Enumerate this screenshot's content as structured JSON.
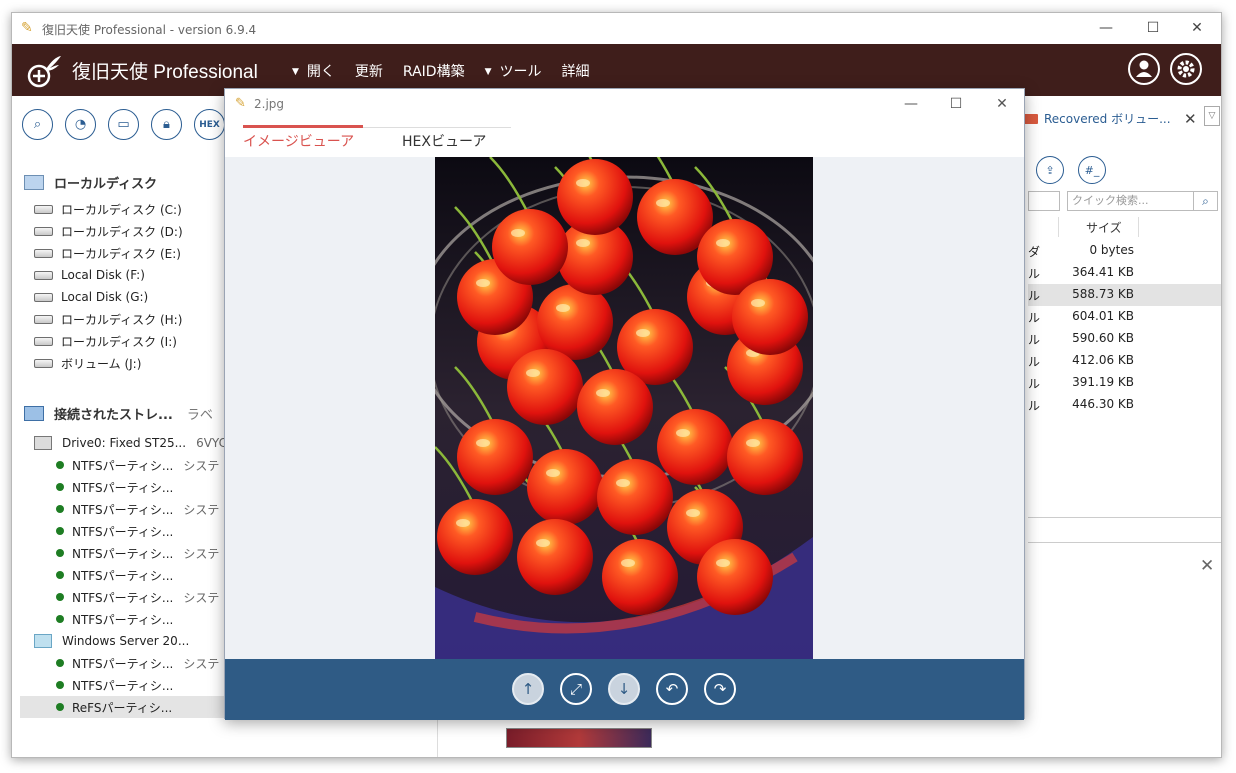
{
  "window": {
    "title": "復旧天使 Professional - version 6.9.4"
  },
  "header": {
    "brand": "復旧天使 Professional",
    "menu": [
      {
        "label": "開く",
        "has_caret": true
      },
      {
        "label": "更新",
        "has_caret": false
      },
      {
        "label": "RAID構築",
        "has_caret": false
      },
      {
        "label": "ツール",
        "has_caret": true
      },
      {
        "label": "詳細",
        "has_caret": false
      }
    ],
    "account_icon": "user-icon",
    "settings_icon": "gear-icon"
  },
  "left_panel": {
    "tools": [
      "search-icon",
      "pie-chart-icon",
      "disk-image-icon",
      "lock-icon"
    ],
    "hex_label": "HEX",
    "local_disk_heading": "ローカルディスク",
    "local_disks": [
      "ローカルディスク (C:)",
      "ローカルディスク (D:)",
      "ローカルディスク (E:)",
      "Local Disk (F:)",
      "Local Disk (G:)",
      "ローカルディスク (H:)",
      "ローカルディスク (I:)",
      "ボリューム (J:)"
    ],
    "storage_heading": "接続されたストレ...",
    "storage_heading_extra": "ラベ",
    "storage": [
      {
        "kind": "drive",
        "label": "Drive0: Fixed ST25...",
        "extra": "6VYC"
      },
      {
        "kind": "partition",
        "label": "NTFSパーティシ...",
        "extra": "システ"
      },
      {
        "kind": "partition",
        "label": "NTFSパーティシ...",
        "extra": ""
      },
      {
        "kind": "partition",
        "label": "NTFSパーティシ...",
        "extra": "システ"
      },
      {
        "kind": "partition",
        "label": "NTFSパーティシ...",
        "extra": ""
      },
      {
        "kind": "partition",
        "label": "NTFSパーティシ...",
        "extra": "システ"
      },
      {
        "kind": "partition",
        "label": "NTFSパーティシ...",
        "extra": ""
      },
      {
        "kind": "partition",
        "label": "NTFSパーティシ...",
        "extra": "システ"
      },
      {
        "kind": "partition",
        "label": "NTFSパーティシ...",
        "extra": ""
      },
      {
        "kind": "drive-win",
        "label": "Windows Server 20...",
        "extra": ""
      },
      {
        "kind": "partition",
        "label": "NTFSパーティシ...",
        "extra": "システ"
      },
      {
        "kind": "partition",
        "label": "NTFSパーティシ...",
        "extra": ""
      },
      {
        "kind": "partition-selected",
        "label": "ReFSパーティシ...",
        "extra": ""
      }
    ]
  },
  "right_panel": {
    "tab_label": "Recovered ボリュー...",
    "search_placeholder": "クイック検索...",
    "size_header": "サイズ",
    "hash_label": "#_",
    "files": [
      {
        "type": "ダ",
        "size": "0 bytes"
      },
      {
        "type": "ル",
        "size": "364.41 KB"
      },
      {
        "type": "ル",
        "size": "588.73 KB"
      },
      {
        "type": "ル",
        "size": "604.01 KB"
      },
      {
        "type": "ル",
        "size": "590.60 KB"
      },
      {
        "type": "ル",
        "size": "412.06 KB"
      },
      {
        "type": "ル",
        "size": "391.19 KB"
      },
      {
        "type": "ル",
        "size": "446.30 KB"
      }
    ],
    "highlight_index": 2
  },
  "viewer": {
    "filename": "2.jpg",
    "tab_image": "イメージビューア",
    "tab_hex": "HEXビューア",
    "toolbar": [
      "arrow-up-icon",
      "fit-screen-icon",
      "arrow-down-icon",
      "rotate-left-icon",
      "rotate-right-icon"
    ]
  }
}
